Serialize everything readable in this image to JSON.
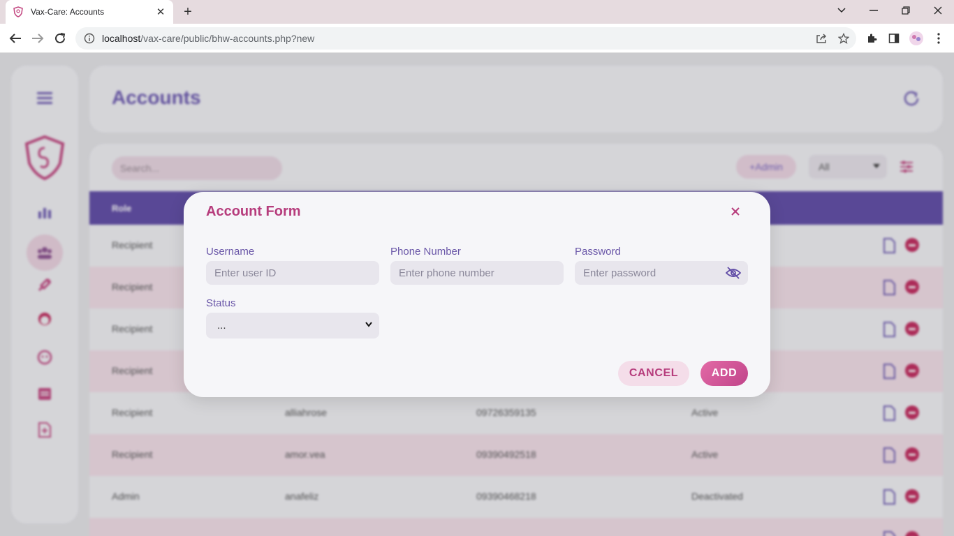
{
  "browser": {
    "tab_title": "Vax-Care: Accounts",
    "url_host": "localhost",
    "url_path": "/vax-care/public/bhw-accounts.php?new"
  },
  "page": {
    "title": "Accounts",
    "search_placeholder": "Search...",
    "admin_button": "+Admin",
    "filter_value": "All",
    "columns": [
      "Role"
    ],
    "rows": [
      {
        "role": "Recipient",
        "username": "",
        "phone": "",
        "status": ""
      },
      {
        "role": "Recipient",
        "username": "",
        "phone": "",
        "status": ""
      },
      {
        "role": "Recipient",
        "username": "",
        "phone": "",
        "status": ""
      },
      {
        "role": "Recipient",
        "username": "",
        "phone": "",
        "status": ""
      },
      {
        "role": "Recipient",
        "username": "alliahrose",
        "phone": "09726359135",
        "status": "Active"
      },
      {
        "role": "Recipient",
        "username": "amor.vea",
        "phone": "09390492518",
        "status": "Active"
      },
      {
        "role": "Admin",
        "username": "anafeliz",
        "phone": "09390468218",
        "status": "Deactivated"
      }
    ]
  },
  "modal": {
    "title": "Account Form",
    "username_label": "Username",
    "username_placeholder": "Enter user ID",
    "phone_label": "Phone Number",
    "phone_placeholder": "Enter phone number",
    "password_label": "Password",
    "password_placeholder": "Enter password",
    "status_label": "Status",
    "status_value": "...",
    "cancel_label": "CANCEL",
    "add_label": "ADD"
  },
  "colors": {
    "accent_purple": "#5f4aa6",
    "accent_pink": "#b63c7c",
    "row_alt": "#f3dfe8"
  },
  "icons": [
    "shield-favicon-icon",
    "close-tab-icon",
    "new-tab-icon",
    "minimize-icon",
    "restore-icon",
    "window-close-icon",
    "back-icon",
    "forward-icon",
    "reload-icon",
    "info-icon",
    "share-icon",
    "star-icon",
    "extensions-icon",
    "sidepanel-icon",
    "profile-avatar",
    "menu-icon",
    "hamburger-icon",
    "logo-icon",
    "chart-icon",
    "users-icon",
    "syringe-icon",
    "baby-icon",
    "child-icon",
    "calendar-icon",
    "report-icon",
    "refresh-icon",
    "sliders-icon",
    "edit-icon",
    "delete-icon",
    "eye-off-icon",
    "chevron-down-icon"
  ]
}
